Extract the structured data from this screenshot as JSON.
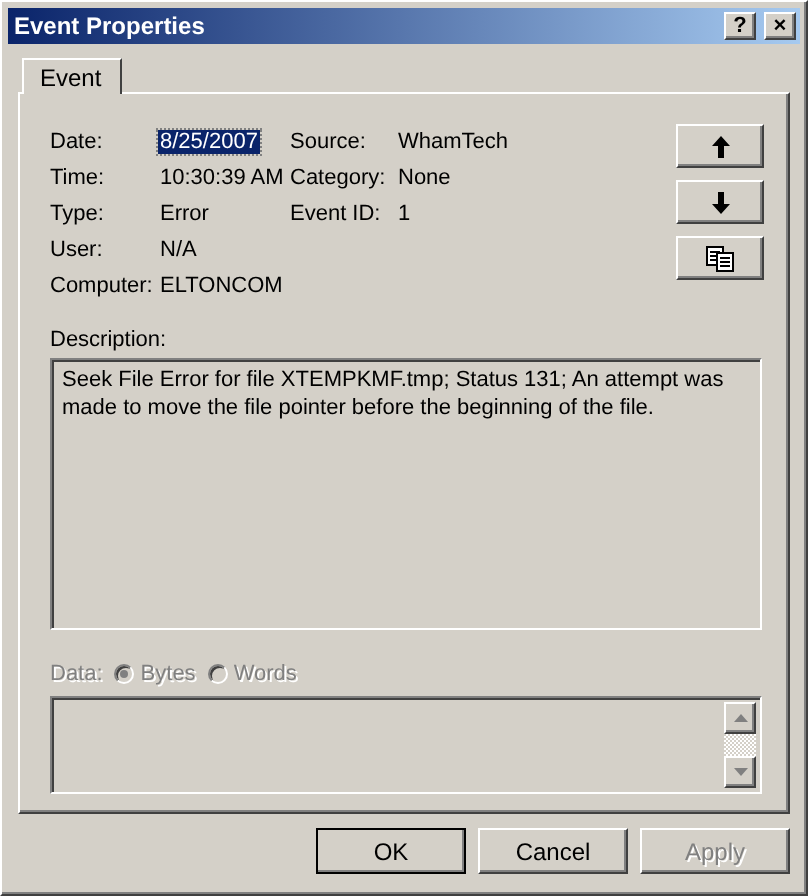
{
  "window": {
    "title": "Event Properties",
    "title_buttons": [
      {
        "kind": "help",
        "label": "?"
      },
      {
        "kind": "close",
        "label": "×"
      }
    ]
  },
  "tabs": [
    {
      "label": "Event",
      "selected": true
    }
  ],
  "field_rows": [
    [
      {
        "label": "Date:",
        "value": "8/25/2007",
        "selected": true
      },
      {
        "label": "Source:",
        "value": "WhamTech",
        "selected": false
      }
    ],
    [
      {
        "label": "Time:",
        "value": "10:30:39 AM",
        "selected": false
      },
      {
        "label": "Category:",
        "value": "None",
        "selected": false
      }
    ],
    [
      {
        "label": "Type:",
        "value": "Error",
        "selected": false
      },
      {
        "label": "Event ID:",
        "value": "1",
        "selected": false
      }
    ],
    [
      {
        "label": "User:",
        "value": "N/A",
        "selected": false
      }
    ],
    [
      {
        "label": "Computer:",
        "value": "ELTONCOM",
        "selected": false
      }
    ]
  ],
  "side_buttons": [
    {
      "kind": "up"
    },
    {
      "kind": "down"
    },
    {
      "kind": "copy"
    }
  ],
  "description": {
    "label": "Description:",
    "text": "Seek File Error for file XTEMPKMF.tmp; Status 131; An attempt was made to move the file pointer before the beginning of the file."
  },
  "data": {
    "label": "Data:",
    "disabled": true,
    "options": [
      {
        "label": "Bytes",
        "selected": true
      },
      {
        "label": "Words",
        "selected": false
      }
    ]
  },
  "buttons": [
    {
      "label": "OK",
      "default": true,
      "disabled": false
    },
    {
      "label": "Cancel",
      "default": false,
      "disabled": false
    },
    {
      "label": "Apply",
      "default": false,
      "disabled": true
    }
  ]
}
